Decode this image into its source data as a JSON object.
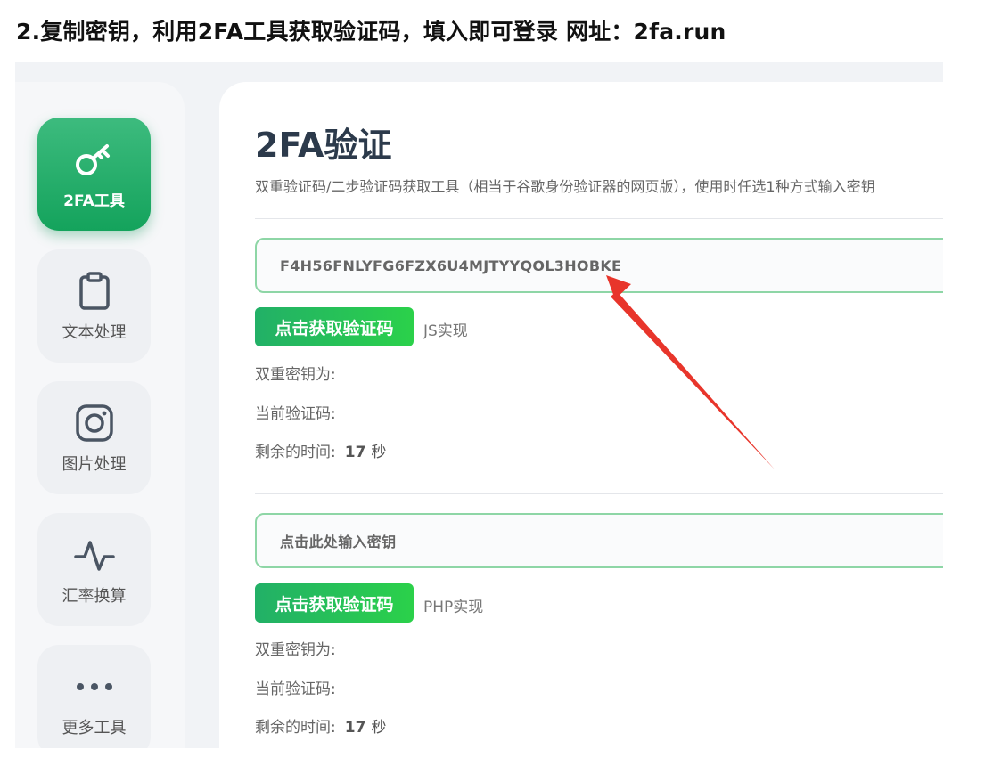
{
  "caption": "2.复制密钥，利用2FA工具获取验证码，填入即可登录   网址：2fa.run",
  "sidebar": {
    "items": [
      {
        "label": "2FA工具",
        "icon": "key-icon"
      },
      {
        "label": "文本处理",
        "icon": "clipboard-icon"
      },
      {
        "label": "图片处理",
        "icon": "instagram-icon"
      },
      {
        "label": "汇率换算",
        "icon": "pulse-icon"
      },
      {
        "label": "更多工具",
        "icon": "more-dots-icon"
      }
    ]
  },
  "main": {
    "title": "2FA验证",
    "description": "双重验证码/二步验证码获取工具（相当于谷歌身份验证器的网页版），使用时任选1种方式输入密钥",
    "js_section": {
      "key_value": "F4H56FNLYFG6FZX6U4MJTYYQOL3HOBKE",
      "button_label": "点击获取验证码",
      "impl_label": "JS实现",
      "secret_label": "双重密钥为:",
      "code_label": "当前验证码:",
      "remaining_label": "剩余的时间:",
      "remaining_value": "17",
      "remaining_unit": "秒"
    },
    "php_section": {
      "key_placeholder": "点击此处输入密钥",
      "button_label": "点击获取验证码",
      "impl_label": "PHP实现",
      "secret_label": "双重密钥为:",
      "code_label": "当前验证码:",
      "remaining_label": "剩余的时间:",
      "remaining_value": "17",
      "remaining_unit": "秒"
    }
  },
  "colors": {
    "accent": "#1faa63",
    "annotation_arrow": "#e8352b"
  }
}
